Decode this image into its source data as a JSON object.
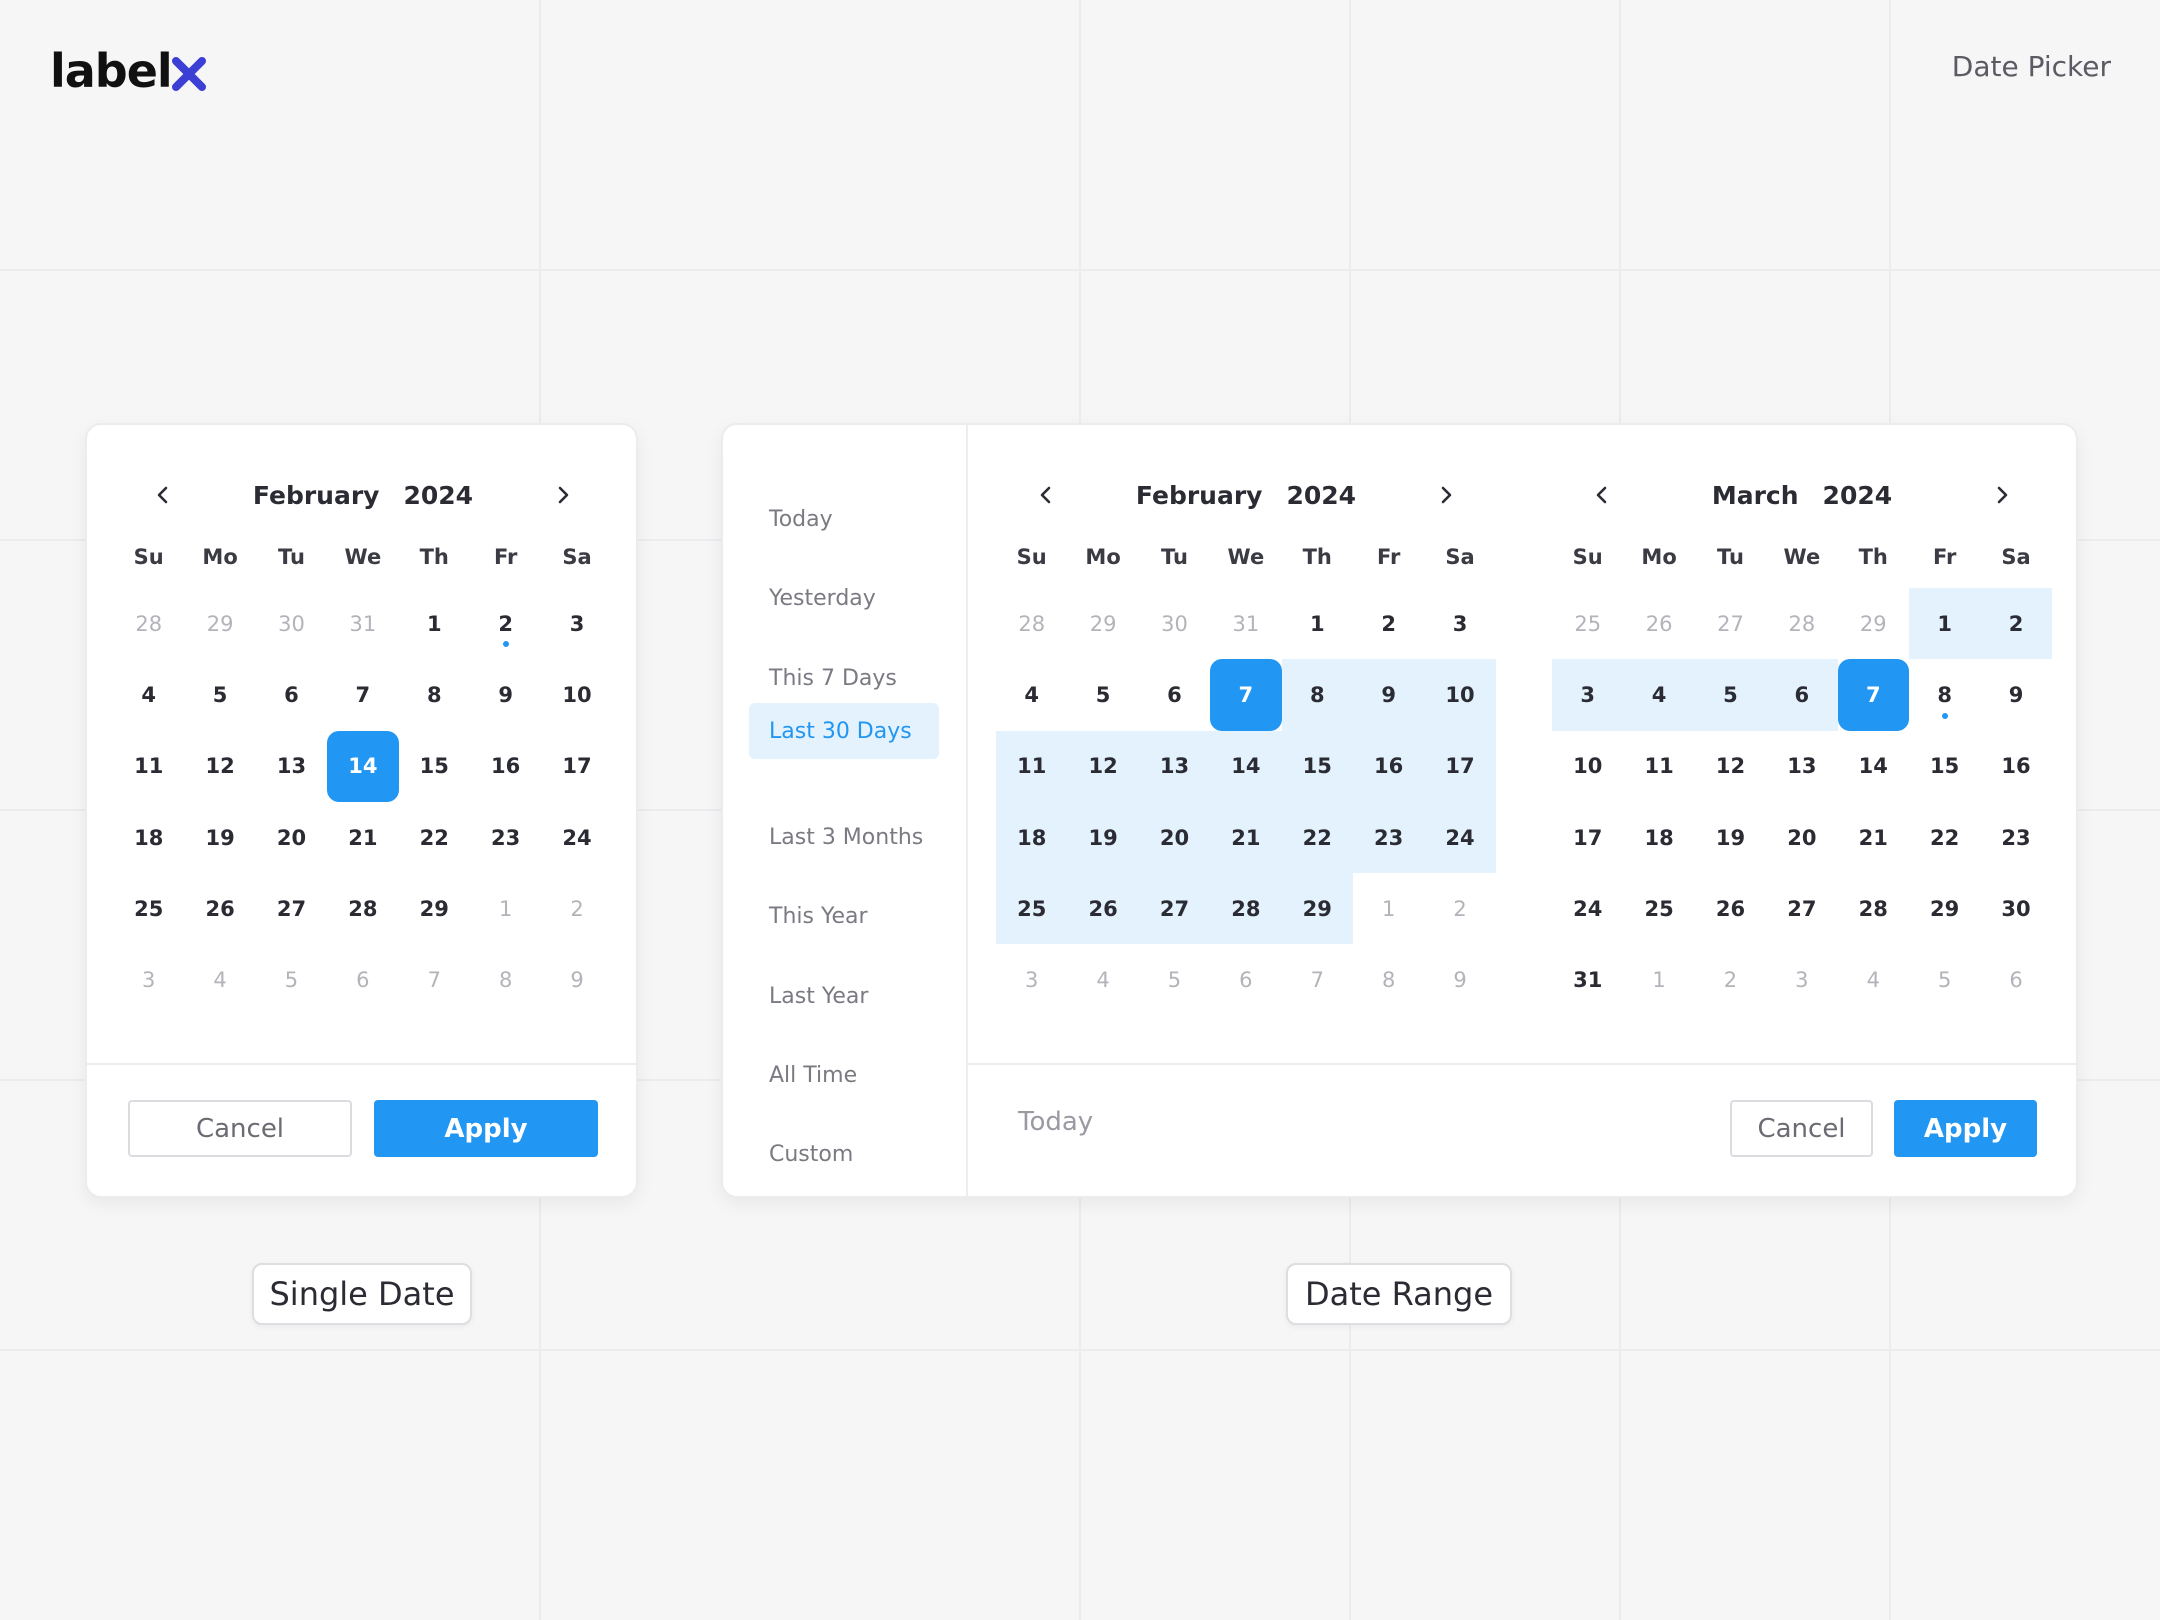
{
  "brand": {
    "logo_text": "label",
    "logo_accent": "x"
  },
  "page_title": "Date Picker",
  "colors": {
    "accent": "#2196f3",
    "range_fill": "#e3f2fd",
    "logo_accent": "#3b3fd4"
  },
  "icons": {
    "prev": "chevron-left-icon",
    "next": "chevron-right-icon"
  },
  "weekdays": [
    "Su",
    "Mo",
    "Tu",
    "We",
    "Th",
    "Fr",
    "Sa"
  ],
  "single": {
    "month": "February",
    "year": "2024",
    "cancel_label": "Cancel",
    "apply_label": "Apply",
    "caption": "Single Date",
    "days": [
      {
        "d": "28",
        "muted": true
      },
      {
        "d": "29",
        "muted": true
      },
      {
        "d": "30",
        "muted": true
      },
      {
        "d": "31",
        "muted": true
      },
      {
        "d": "1"
      },
      {
        "d": "2",
        "today": true
      },
      {
        "d": "3"
      },
      {
        "d": "4"
      },
      {
        "d": "5"
      },
      {
        "d": "6"
      },
      {
        "d": "7"
      },
      {
        "d": "8"
      },
      {
        "d": "9"
      },
      {
        "d": "10"
      },
      {
        "d": "11"
      },
      {
        "d": "12"
      },
      {
        "d": "13"
      },
      {
        "d": "14",
        "selected": true
      },
      {
        "d": "15"
      },
      {
        "d": "16"
      },
      {
        "d": "17"
      },
      {
        "d": "18"
      },
      {
        "d": "19"
      },
      {
        "d": "20"
      },
      {
        "d": "21"
      },
      {
        "d": "22"
      },
      {
        "d": "23"
      },
      {
        "d": "24"
      },
      {
        "d": "25"
      },
      {
        "d": "26"
      },
      {
        "d": "27"
      },
      {
        "d": "28"
      },
      {
        "d": "29"
      },
      {
        "d": "1",
        "muted": true
      },
      {
        "d": "2",
        "muted": true
      },
      {
        "d": "3",
        "muted": true
      },
      {
        "d": "4",
        "muted": true
      },
      {
        "d": "5",
        "muted": true
      },
      {
        "d": "6",
        "muted": true
      },
      {
        "d": "7",
        "muted": true
      },
      {
        "d": "8",
        "muted": true
      },
      {
        "d": "9",
        "muted": true
      }
    ]
  },
  "range": {
    "presets": [
      {
        "label": "Today"
      },
      {
        "label": "Yesterday"
      },
      {
        "label": "This 7 Days"
      },
      {
        "label": "Last 30 Days",
        "active": true
      },
      {
        "label": "Last 3 Months"
      },
      {
        "label": "This Year"
      },
      {
        "label": "Last Year"
      },
      {
        "label": "All Time"
      },
      {
        "label": "Custom"
      }
    ],
    "footer_today": "Today",
    "cancel_label": "Cancel",
    "apply_label": "Apply",
    "caption": "Date Range",
    "calendars": [
      {
        "month": "February",
        "year": "2024",
        "days": [
          {
            "d": "28",
            "muted": true
          },
          {
            "d": "29",
            "muted": true
          },
          {
            "d": "30",
            "muted": true
          },
          {
            "d": "31",
            "muted": true
          },
          {
            "d": "1"
          },
          {
            "d": "2"
          },
          {
            "d": "3"
          },
          {
            "d": "4"
          },
          {
            "d": "5"
          },
          {
            "d": "6"
          },
          {
            "d": "7",
            "selected": true
          },
          {
            "d": "8",
            "inrange": true
          },
          {
            "d": "9",
            "inrange": true
          },
          {
            "d": "10",
            "inrange": true
          },
          {
            "d": "11",
            "inrange": true
          },
          {
            "d": "12",
            "inrange": true
          },
          {
            "d": "13",
            "inrange": true
          },
          {
            "d": "14",
            "inrange": true
          },
          {
            "d": "15",
            "inrange": true
          },
          {
            "d": "16",
            "inrange": true
          },
          {
            "d": "17",
            "inrange": true
          },
          {
            "d": "18",
            "inrange": true
          },
          {
            "d": "19",
            "inrange": true
          },
          {
            "d": "20",
            "inrange": true
          },
          {
            "d": "21",
            "inrange": true
          },
          {
            "d": "22",
            "inrange": true
          },
          {
            "d": "23",
            "inrange": true
          },
          {
            "d": "24",
            "inrange": true
          },
          {
            "d": "25",
            "inrange": true
          },
          {
            "d": "26",
            "inrange": true
          },
          {
            "d": "27",
            "inrange": true
          },
          {
            "d": "28",
            "inrange": true
          },
          {
            "d": "29",
            "inrange": true
          },
          {
            "d": "1",
            "muted": true
          },
          {
            "d": "2",
            "muted": true
          },
          {
            "d": "3",
            "muted": true
          },
          {
            "d": "4",
            "muted": true
          },
          {
            "d": "5",
            "muted": true
          },
          {
            "d": "6",
            "muted": true
          },
          {
            "d": "7",
            "muted": true
          },
          {
            "d": "8",
            "muted": true
          },
          {
            "d": "9",
            "muted": true
          }
        ]
      },
      {
        "month": "March",
        "year": "2024",
        "days": [
          {
            "d": "25",
            "muted": true
          },
          {
            "d": "26",
            "muted": true
          },
          {
            "d": "27",
            "muted": true
          },
          {
            "d": "28",
            "muted": true
          },
          {
            "d": "29",
            "muted": true
          },
          {
            "d": "1",
            "inrange": true
          },
          {
            "d": "2",
            "inrange": true
          },
          {
            "d": "3",
            "inrange": true
          },
          {
            "d": "4",
            "inrange": true
          },
          {
            "d": "5",
            "inrange": true
          },
          {
            "d": "6",
            "inrange": true
          },
          {
            "d": "7",
            "selected": true
          },
          {
            "d": "8",
            "today": true
          },
          {
            "d": "9"
          },
          {
            "d": "10"
          },
          {
            "d": "11"
          },
          {
            "d": "12"
          },
          {
            "d": "13"
          },
          {
            "d": "14"
          },
          {
            "d": "15"
          },
          {
            "d": "16"
          },
          {
            "d": "17"
          },
          {
            "d": "18"
          },
          {
            "d": "19"
          },
          {
            "d": "20"
          },
          {
            "d": "21"
          },
          {
            "d": "22"
          },
          {
            "d": "23"
          },
          {
            "d": "24"
          },
          {
            "d": "25"
          },
          {
            "d": "26"
          },
          {
            "d": "27"
          },
          {
            "d": "28"
          },
          {
            "d": "29"
          },
          {
            "d": "30"
          },
          {
            "d": "31"
          },
          {
            "d": "1",
            "muted": true
          },
          {
            "d": "2",
            "muted": true
          },
          {
            "d": "3",
            "muted": true
          },
          {
            "d": "4",
            "muted": true
          },
          {
            "d": "5",
            "muted": true
          },
          {
            "d": "6",
            "muted": true
          }
        ]
      }
    ]
  }
}
